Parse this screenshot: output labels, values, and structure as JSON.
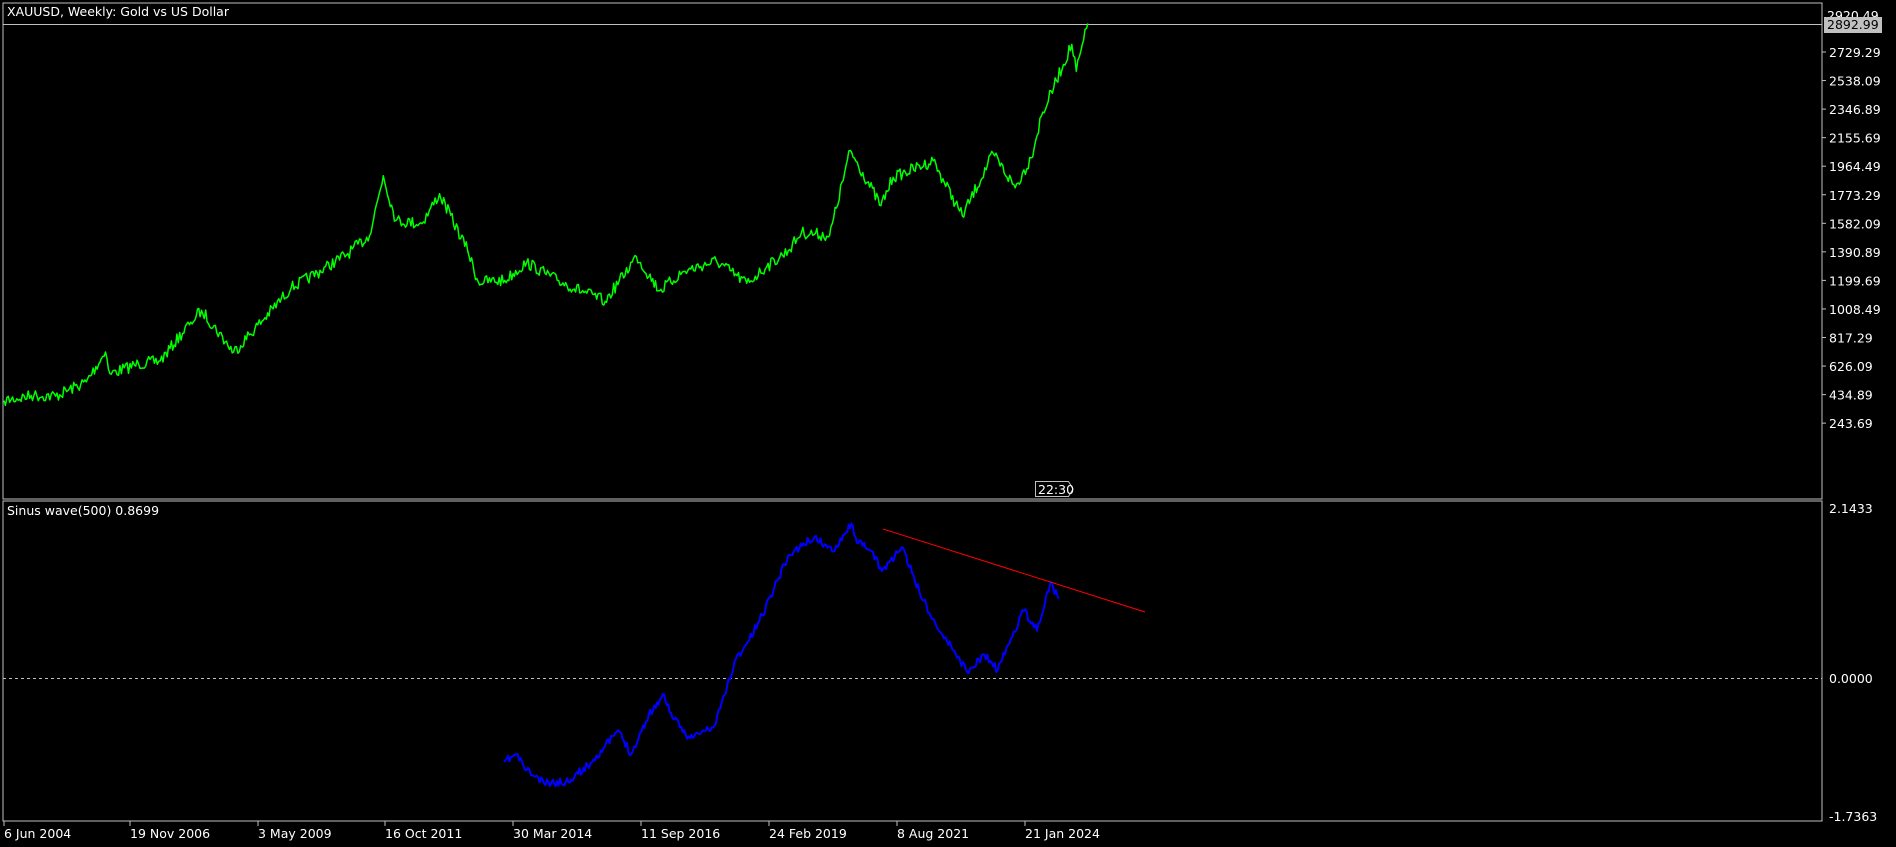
{
  "colors": {
    "background": "#000000",
    "frame": "#c0c0c0",
    "price_line": "#00ff00",
    "indicator_line": "#0000ff",
    "trend_line": "#ff0000",
    "level_line": "#c0c0c0",
    "price_tag_bg": "#c0c0c0",
    "price_tag_text": "#000000"
  },
  "main_chart": {
    "title": "XAUUSD, Weekly:  Gold vs US Dollar",
    "current_price": "2892.99",
    "countdown": "22:30",
    "price_axis": [
      "2729.29",
      "2538.09",
      "2346.89",
      "2155.69",
      "1964.49",
      "1773.29",
      "1582.09",
      "1390.89",
      "1199.69",
      "1008.49",
      "817.29",
      "626.09",
      "434.89",
      "243.69"
    ],
    "top_partial_label": "2920.49"
  },
  "indicator_chart": {
    "title": "Sinus wave(500) 0.8699",
    "axis": [
      "2.1433",
      "0.0000",
      "-1.7363"
    ]
  },
  "time_axis": [
    "6 Jun 2004",
    "19 Nov 2006",
    "3 May 2009",
    "16 Oct 2011",
    "30 Mar 2014",
    "11 Sep 2016",
    "24 Feb 2019",
    "8 Aug 2021",
    "21 Jan 2024"
  ],
  "chart_data": [
    {
      "type": "line",
      "title": "XAUUSD, Weekly:  Gold vs US Dollar",
      "ylim": [
        52.5,
        2920.49
      ],
      "series": [
        {
          "name": "XAUUSD",
          "x": [
            "2004-06-06",
            "2005-01-01",
            "2005-06-01",
            "2006-01-01",
            "2006-05-15",
            "2006-06-15",
            "2007-01-01",
            "2007-06-01",
            "2008-01-01",
            "2008-03-15",
            "2008-10-25",
            "2009-06-01",
            "2009-12-01",
            "2010-06-01",
            "2011-01-01",
            "2011-06-01",
            "2011-09-05",
            "2011-12-01",
            "2012-06-01",
            "2012-10-01",
            "2013-04-15",
            "2013-06-28",
            "2013-12-31",
            "2014-06-01",
            "2015-01-01",
            "2015-12-01",
            "2016-07-06",
            "2016-12-15",
            "2017-06-01",
            "2018-01-15",
            "2018-08-15",
            "2019-01-01",
            "2019-06-01",
            "2019-09-01",
            "2020-03-15",
            "2020-08-06",
            "2021-03-08",
            "2021-06-01",
            "2022-03-08",
            "2022-09-28",
            "2023-05-01",
            "2023-10-01",
            "2024-01-21",
            "2024-04-01",
            "2024-10-30",
            "2024-12-01",
            "2025-02-20"
          ],
          "values": [
            395,
            430,
            425,
            520,
            720,
            575,
            640,
            660,
            920,
            1000,
            720,
            950,
            1150,
            1250,
            1380,
            1500,
            1900,
            1600,
            1580,
            1780,
            1400,
            1190,
            1200,
            1320,
            1200,
            1060,
            1360,
            1130,
            1260,
            1330,
            1180,
            1290,
            1400,
            1520,
            1500,
            2070,
            1700,
            1890,
            2000,
            1630,
            2050,
            1820,
            2020,
            2300,
            2780,
            2600,
            2920
          ]
        }
      ]
    },
    {
      "type": "line",
      "title": "Sinus wave(500) 0.8699",
      "ylim": [
        -1.7363,
        2.1433
      ],
      "series": [
        {
          "name": "Sinus wave(500)",
          "x": [
            "2013-12-25",
            "2014-03-20",
            "2014-06-01",
            "2014-10-01",
            "2015-03-01",
            "2015-08-01",
            "2015-12-01",
            "2016-03-01",
            "2016-06-01",
            "2016-10-01",
            "2017-01-15",
            "2017-03-15",
            "2017-07-15",
            "2018-01-01",
            "2018-06-01",
            "2018-09-01",
            "2018-12-01",
            "2019-06-01",
            "2019-12-01",
            "2020-04-01",
            "2020-08-15",
            "2020-10-01",
            "2021-01-01",
            "2021-03-15",
            "2021-08-01",
            "2021-12-01",
            "2022-04-01",
            "2022-08-01",
            "2022-11-01",
            "2023-03-01",
            "2023-06-01",
            "2023-09-01",
            "2023-12-01",
            "2024-03-01",
            "2024-06-01",
            "2024-08-01"
          ],
          "values": [
            -1.05,
            -0.95,
            -1.15,
            -1.32,
            -1.3,
            -1.1,
            -0.85,
            -0.65,
            -0.95,
            -0.45,
            -0.2,
            -0.5,
            -0.75,
            -0.6,
            0.25,
            0.48,
            0.8,
            1.55,
            1.78,
            1.6,
            1.95,
            1.7,
            1.6,
            1.35,
            1.65,
            1.1,
            0.65,
            0.35,
            0.08,
            0.3,
            0.1,
            0.5,
            0.85,
            0.6,
            1.2,
            1.0
          ]
        }
      ]
    }
  ]
}
